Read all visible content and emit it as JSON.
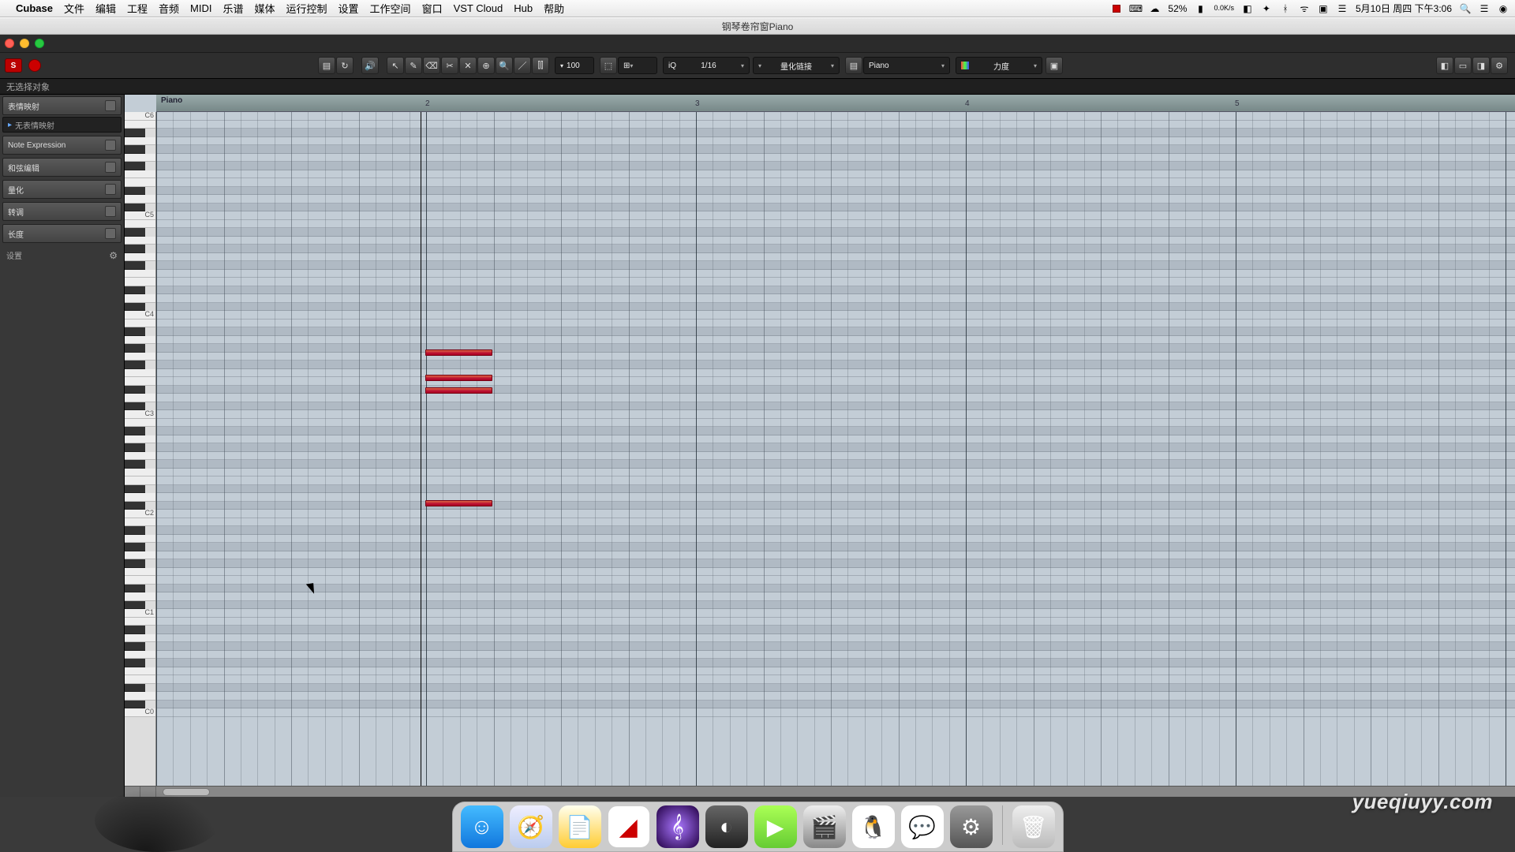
{
  "menubar": {
    "app": "Cubase",
    "items": [
      "文件",
      "编辑",
      "工程",
      "音频",
      "MIDI",
      "乐谱",
      "媒体",
      "运行控制",
      "设置",
      "工作空间",
      "窗口",
      "VST Cloud",
      "Hub",
      "帮助"
    ],
    "battery": "52%",
    "net1": "0.0K/s",
    "net2": "0.0K/s",
    "date": "5月10日 周四 下午3:06"
  },
  "window": {
    "title": "钢琴卷帘窗Piano"
  },
  "toolbar": {
    "solo": "S",
    "vel_label": "100",
    "quant_label": "1/16",
    "snap_label": "量化链接",
    "part_label": "Piano",
    "color_label": "力度"
  },
  "info": {
    "status": "无选择对象"
  },
  "inspector": {
    "r1": "表情映射",
    "r1sub": "无表情映射",
    "r2": "Note Expression",
    "r3": "和弦编辑",
    "r4": "量化",
    "r5": "转调",
    "r6": "长度",
    "setting": "设置"
  },
  "ruler": {
    "part_name": "Piano",
    "bars": [
      "2",
      "3",
      "4",
      "5"
    ]
  },
  "piano": {
    "labels": [
      "C5",
      "C4",
      "C3",
      "C2",
      "C1",
      "C0"
    ]
  },
  "watermark": "yueqiuyy.com"
}
